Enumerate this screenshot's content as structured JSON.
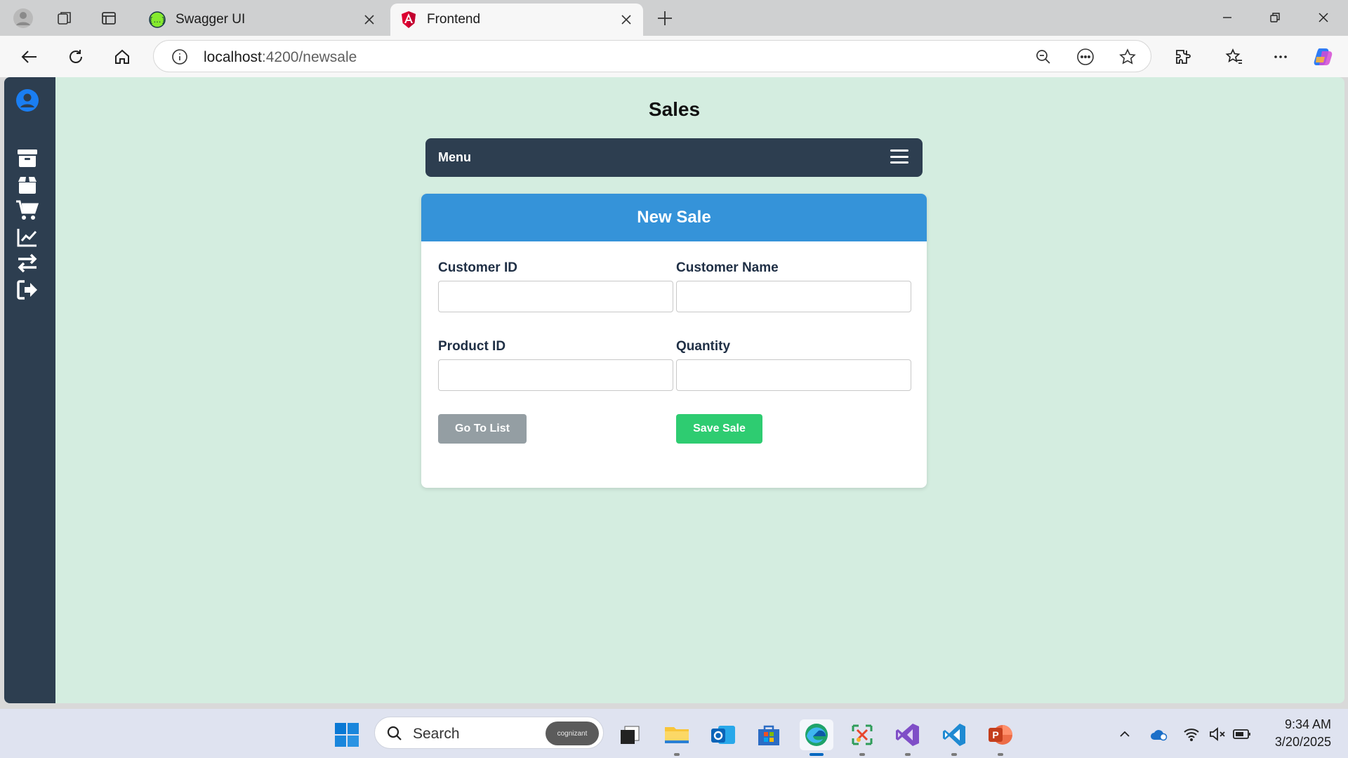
{
  "browser": {
    "tabs": [
      {
        "label": "Swagger UI",
        "active": false,
        "favicon": "swagger-icon"
      },
      {
        "label": "Frontend",
        "active": true,
        "favicon": "angular-icon"
      }
    ],
    "address": {
      "host": "localhost",
      "rest": ":4200/newsale"
    }
  },
  "app": {
    "title": "Sales",
    "menu_label": "Menu",
    "sidebar_icons": [
      "user-icon",
      "archive-icon",
      "box-icon",
      "cart-icon",
      "chart-icon",
      "transfer-icon",
      "logout-icon"
    ],
    "form": {
      "header": "New Sale",
      "customer_id_label": "Customer ID",
      "customer_name_label": "Customer Name",
      "product_id_label": "Product ID",
      "quantity_label": "Quantity",
      "customer_id_value": "",
      "customer_name_value": "",
      "product_id_value": "",
      "quantity_value": "",
      "go_to_list_label": "Go To List",
      "save_label": "Save Sale"
    }
  },
  "taskbar": {
    "search_placeholder": "Search",
    "search_badge": "cognizant",
    "time": "9:34 AM",
    "date": "3/20/2025"
  },
  "colors": {
    "page_bg": "#d4ede0",
    "sidebar_bg": "#2d3e50",
    "card_header": "#3593d9",
    "save_button": "#2ecc71",
    "go_to_list_button": "#949ea3"
  }
}
